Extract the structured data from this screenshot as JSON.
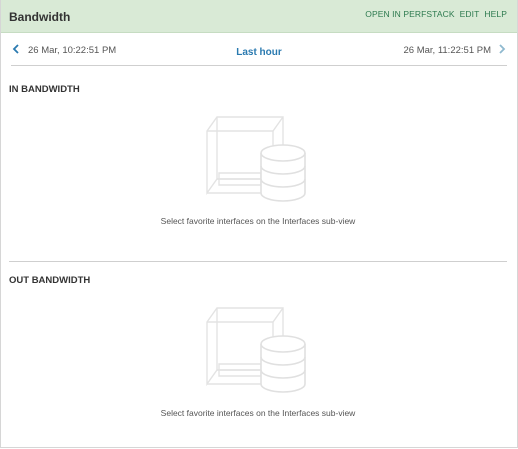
{
  "widget": {
    "title": "Bandwidth",
    "actions": {
      "open_perfstack": "OPEN IN PERFSTACK",
      "edit": "EDIT",
      "help": "HELP"
    }
  },
  "timebar": {
    "start": "26 Mar, 10:22:51 PM",
    "range": "Last hour",
    "end": "26 Mar, 11:22:51 PM"
  },
  "sections": {
    "in": {
      "title": "IN BANDWIDTH",
      "message": "Select favorite interfaces on the Interfaces sub-view"
    },
    "out": {
      "title": "OUT BANDWIDTH",
      "message": "Select favorite interfaces on the Interfaces sub-view"
    }
  },
  "icons": {
    "prev": "chevron-left-icon",
    "next": "chevron-right-icon",
    "empty_state": "box-database-icon"
  },
  "colors": {
    "header_bg": "#d9ead6",
    "action_link": "#2d7a4f",
    "range_link": "#2a7ab0"
  }
}
